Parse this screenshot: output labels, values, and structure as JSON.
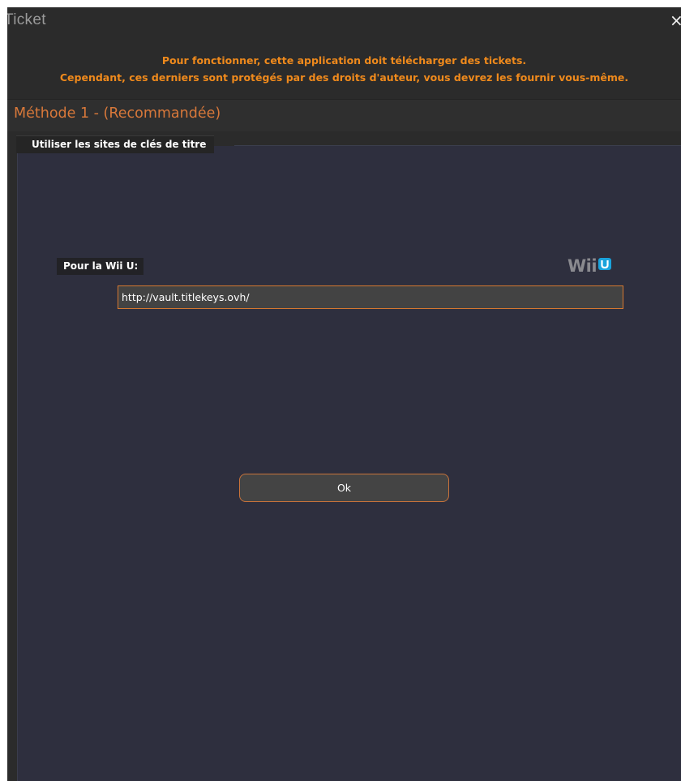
{
  "window": {
    "title": "Ticket",
    "close_label": "×"
  },
  "notice": {
    "line1": "Pour fonctionner, cette application doit télécharger des tickets.",
    "line2": "Cependant, ces derniers sont protégés par des droits d'auteur, vous devrez les fournir vous-même."
  },
  "method": {
    "title": "Méthode 1 - (Recommandée)"
  },
  "tab": {
    "label": "Utiliser les sites de clés de titre"
  },
  "wiiu": {
    "label": "Pour la Wii U:",
    "logo_text": "Wii",
    "logo_u_icon": "wii-u-icon",
    "url_value": "http://vault.titlekeys.ovh/"
  },
  "actions": {
    "ok_label": "Ok"
  },
  "colors": {
    "accent_orange": "#f08a1c",
    "method_title": "#d8783a",
    "panel_bg": "#2e2f3e",
    "wii_u_blue": "#1aa3dc"
  }
}
